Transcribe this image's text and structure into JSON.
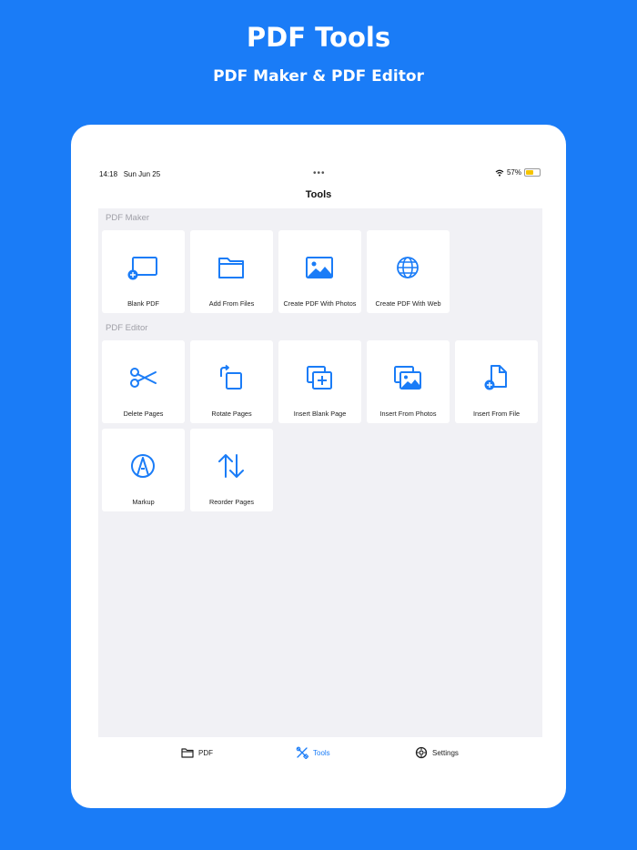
{
  "hero": {
    "title": "PDF Tools",
    "subtitle": "PDF Maker & PDF Editor"
  },
  "status_bar": {
    "time": "14:18",
    "date": "Sun Jun 25",
    "dots": "•••",
    "battery_percent": "57%",
    "battery_level": 0.57
  },
  "nav": {
    "title": "Tools"
  },
  "sections": {
    "maker": {
      "title": "PDF Maker",
      "items": [
        {
          "label": "Blank PDF",
          "icon": "blank-pdf-icon"
        },
        {
          "label": "Add From Files",
          "icon": "folder-icon"
        },
        {
          "label": "Create PDF With Photos",
          "icon": "photo-icon"
        },
        {
          "label": "Create PDF With Web",
          "icon": "globe-icon"
        }
      ]
    },
    "editor": {
      "title": "PDF Editor",
      "items": [
        {
          "label": "Delete Pages",
          "icon": "scissors-icon"
        },
        {
          "label": "Rotate Pages",
          "icon": "rotate-icon"
        },
        {
          "label": "Insert Blank Page",
          "icon": "insert-blank-page-icon"
        },
        {
          "label": "Insert From Photos",
          "icon": "insert-photos-icon"
        },
        {
          "label": "Insert From File",
          "icon": "insert-file-icon"
        },
        {
          "label": "Markup",
          "icon": "markup-pen-icon"
        },
        {
          "label": "Reorder Pages",
          "icon": "reorder-arrows-icon"
        }
      ]
    }
  },
  "tabs": [
    {
      "label": "PDF",
      "icon": "folder-icon",
      "active": false
    },
    {
      "label": "Tools",
      "icon": "tools-icon",
      "active": true
    },
    {
      "label": "Settings",
      "icon": "settings-icon",
      "active": false
    }
  ],
  "colors": {
    "accent": "#1a7cf7",
    "background": "#1a7cf7",
    "content_bg": "#f1f1f5",
    "battery": "#f5c400"
  }
}
